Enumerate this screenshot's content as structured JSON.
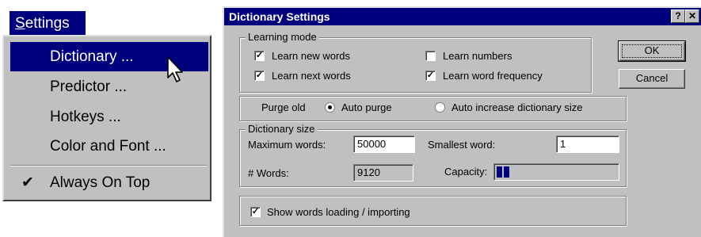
{
  "menu": {
    "title": "Settings",
    "items": [
      {
        "label": "Dictionary ...",
        "selected": true
      },
      {
        "label": "Predictor ..."
      },
      {
        "label": "Hotkeys ..."
      },
      {
        "label": "Color and Font ..."
      }
    ],
    "toggle": {
      "label": "Always On Top",
      "checked": true,
      "check_glyph": "✔"
    }
  },
  "dialog": {
    "title": "Dictionary Settings",
    "help_glyph": "?",
    "close_glyph": "✕",
    "learning_mode": {
      "label": "Learning mode",
      "options": [
        {
          "label": "Learn new words",
          "checked": true
        },
        {
          "label": "Learn numbers",
          "checked": false
        },
        {
          "label": "Learn next words",
          "checked": true
        },
        {
          "label": "Learn word frequency",
          "checked": true
        }
      ]
    },
    "purge": {
      "label": "Purge old",
      "options": [
        {
          "label": "Auto purge",
          "selected": true
        },
        {
          "label": "Auto increase dictionary size",
          "selected": false
        }
      ]
    },
    "dictionary_size": {
      "label": "Dictionary size",
      "max_words_label": "Maximum words:",
      "max_words_value": "50000",
      "smallest_word_label": "Smallest word:",
      "smallest_word_value": "1",
      "words_label": "# Words:",
      "words_value": "9120",
      "capacity_label": "Capacity:"
    },
    "show_loading": {
      "label": "Show words loading / importing",
      "checked": true
    },
    "buttons": {
      "ok": "OK",
      "cancel": "Cancel"
    },
    "check_glyph": "✓"
  },
  "colors": {
    "selection": "#00007f",
    "face": "#c0c0c0"
  }
}
